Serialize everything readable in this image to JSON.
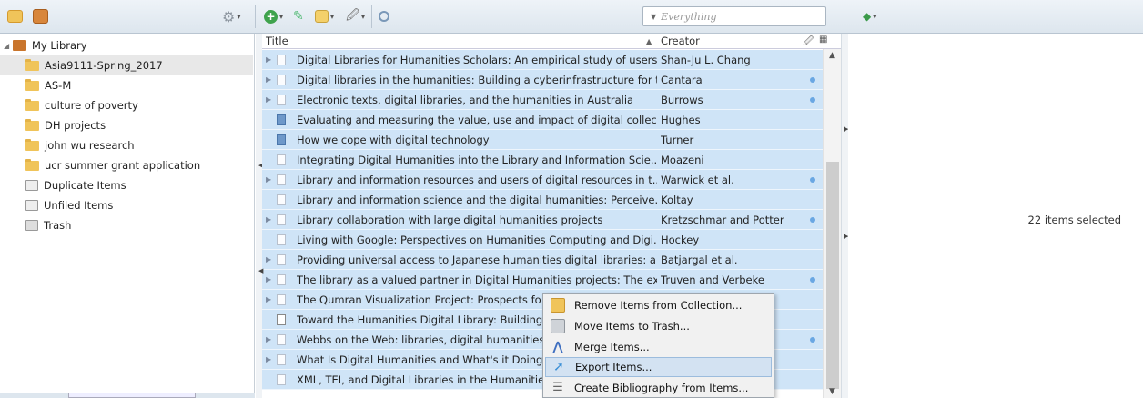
{
  "toolbar": {
    "search_placeholder": "Everything"
  },
  "library": {
    "root": "My Library",
    "items": [
      {
        "label": "Asia9111-Spring_2017",
        "selected": true
      },
      {
        "label": "AS-M"
      },
      {
        "label": "culture of poverty"
      },
      {
        "label": "DH projects"
      },
      {
        "label": "john wu research"
      },
      {
        "label": "ucr summer grant application"
      },
      {
        "label": "Duplicate Items"
      },
      {
        "label": "Unfiled Items"
      },
      {
        "label": "Trash"
      }
    ]
  },
  "items_table": {
    "columns": {
      "title": "Title",
      "creator": "Creator"
    },
    "rows": [
      {
        "title": "Digital Libraries for Humanities Scholars: An empirical study of users...",
        "creator": "Shan-Ju L. Chang",
        "has_children": true,
        "icon": "doc",
        "attachment": false
      },
      {
        "title": "Digital libraries in the humanities: Building a cyberinfrastructure for t...",
        "creator": "Cantara",
        "has_children": true,
        "icon": "doc",
        "attachment": true
      },
      {
        "title": "Electronic texts, digital libraries, and the humanities in Australia",
        "creator": "Burrows",
        "has_children": true,
        "icon": "doc",
        "attachment": true
      },
      {
        "title": "Evaluating and measuring the value, use and impact of digital collec...",
        "creator": "Hughes",
        "has_children": false,
        "icon": "book",
        "attachment": false
      },
      {
        "title": "How we cope with digital technology",
        "creator": "Turner",
        "has_children": false,
        "icon": "book",
        "attachment": false
      },
      {
        "title": "Integrating Digital Humanities into the Library and Information Scie...",
        "creator": "Moazeni",
        "has_children": false,
        "icon": "doc",
        "attachment": false
      },
      {
        "title": "Library and information resources and users of digital resources in t...",
        "creator": "Warwick et al.",
        "has_children": true,
        "icon": "doc",
        "attachment": true
      },
      {
        "title": "Library and information science and the digital humanities: Perceive...",
        "creator": "Koltay",
        "has_children": false,
        "icon": "doc",
        "attachment": false
      },
      {
        "title": "Library collaboration with large digital humanities projects",
        "creator": "Kretzschmar and Potter",
        "has_children": true,
        "icon": "doc",
        "attachment": true
      },
      {
        "title": "Living with Google: Perspectives on Humanities Computing and Digi...",
        "creator": "Hockey",
        "has_children": false,
        "icon": "doc",
        "attachment": false
      },
      {
        "title": "Providing universal access to Japanese humanities digital libraries: a...",
        "creator": "Batjargal et al.",
        "has_children": true,
        "icon": "doc",
        "attachment": false
      },
      {
        "title": "The library as a valued partner in Digital Humanities projects: The ex...",
        "creator": "Truven and Verbeke",
        "has_children": true,
        "icon": "doc",
        "attachment": true
      },
      {
        "title": "The Qumran Visualization Project: Prospects fo",
        "creator": "",
        "has_children": true,
        "icon": "doc",
        "attachment": false
      },
      {
        "title": "Toward the Humanities Digital Library: Building",
        "creator": "",
        "has_children": false,
        "icon": "note",
        "attachment": false
      },
      {
        "title": "Webbs on the Web: libraries, digital humanities",
        "creator": "",
        "has_children": true,
        "icon": "doc",
        "attachment": true
      },
      {
        "title": "What Is Digital Humanities and What's it Doing",
        "creator": "",
        "has_children": true,
        "icon": "doc",
        "attachment": false
      },
      {
        "title": "XML, TEI, and Digital Libraries in the Humanitie",
        "creator": "",
        "has_children": false,
        "icon": "doc",
        "attachment": false
      }
    ]
  },
  "right_pane": {
    "status": "22 items selected"
  },
  "context_menu": {
    "items": [
      {
        "label": "Remove Items from Collection..."
      },
      {
        "label": "Move Items to Trash..."
      },
      {
        "label": "Merge Items..."
      },
      {
        "label": "Export Items...",
        "highlighted": true
      },
      {
        "label": "Create Bibliography from Items..."
      }
    ]
  },
  "colors": {
    "selection": "#cfe4f7",
    "menu_highlight": "#d3e2f2",
    "folder": "#f0c45a"
  }
}
